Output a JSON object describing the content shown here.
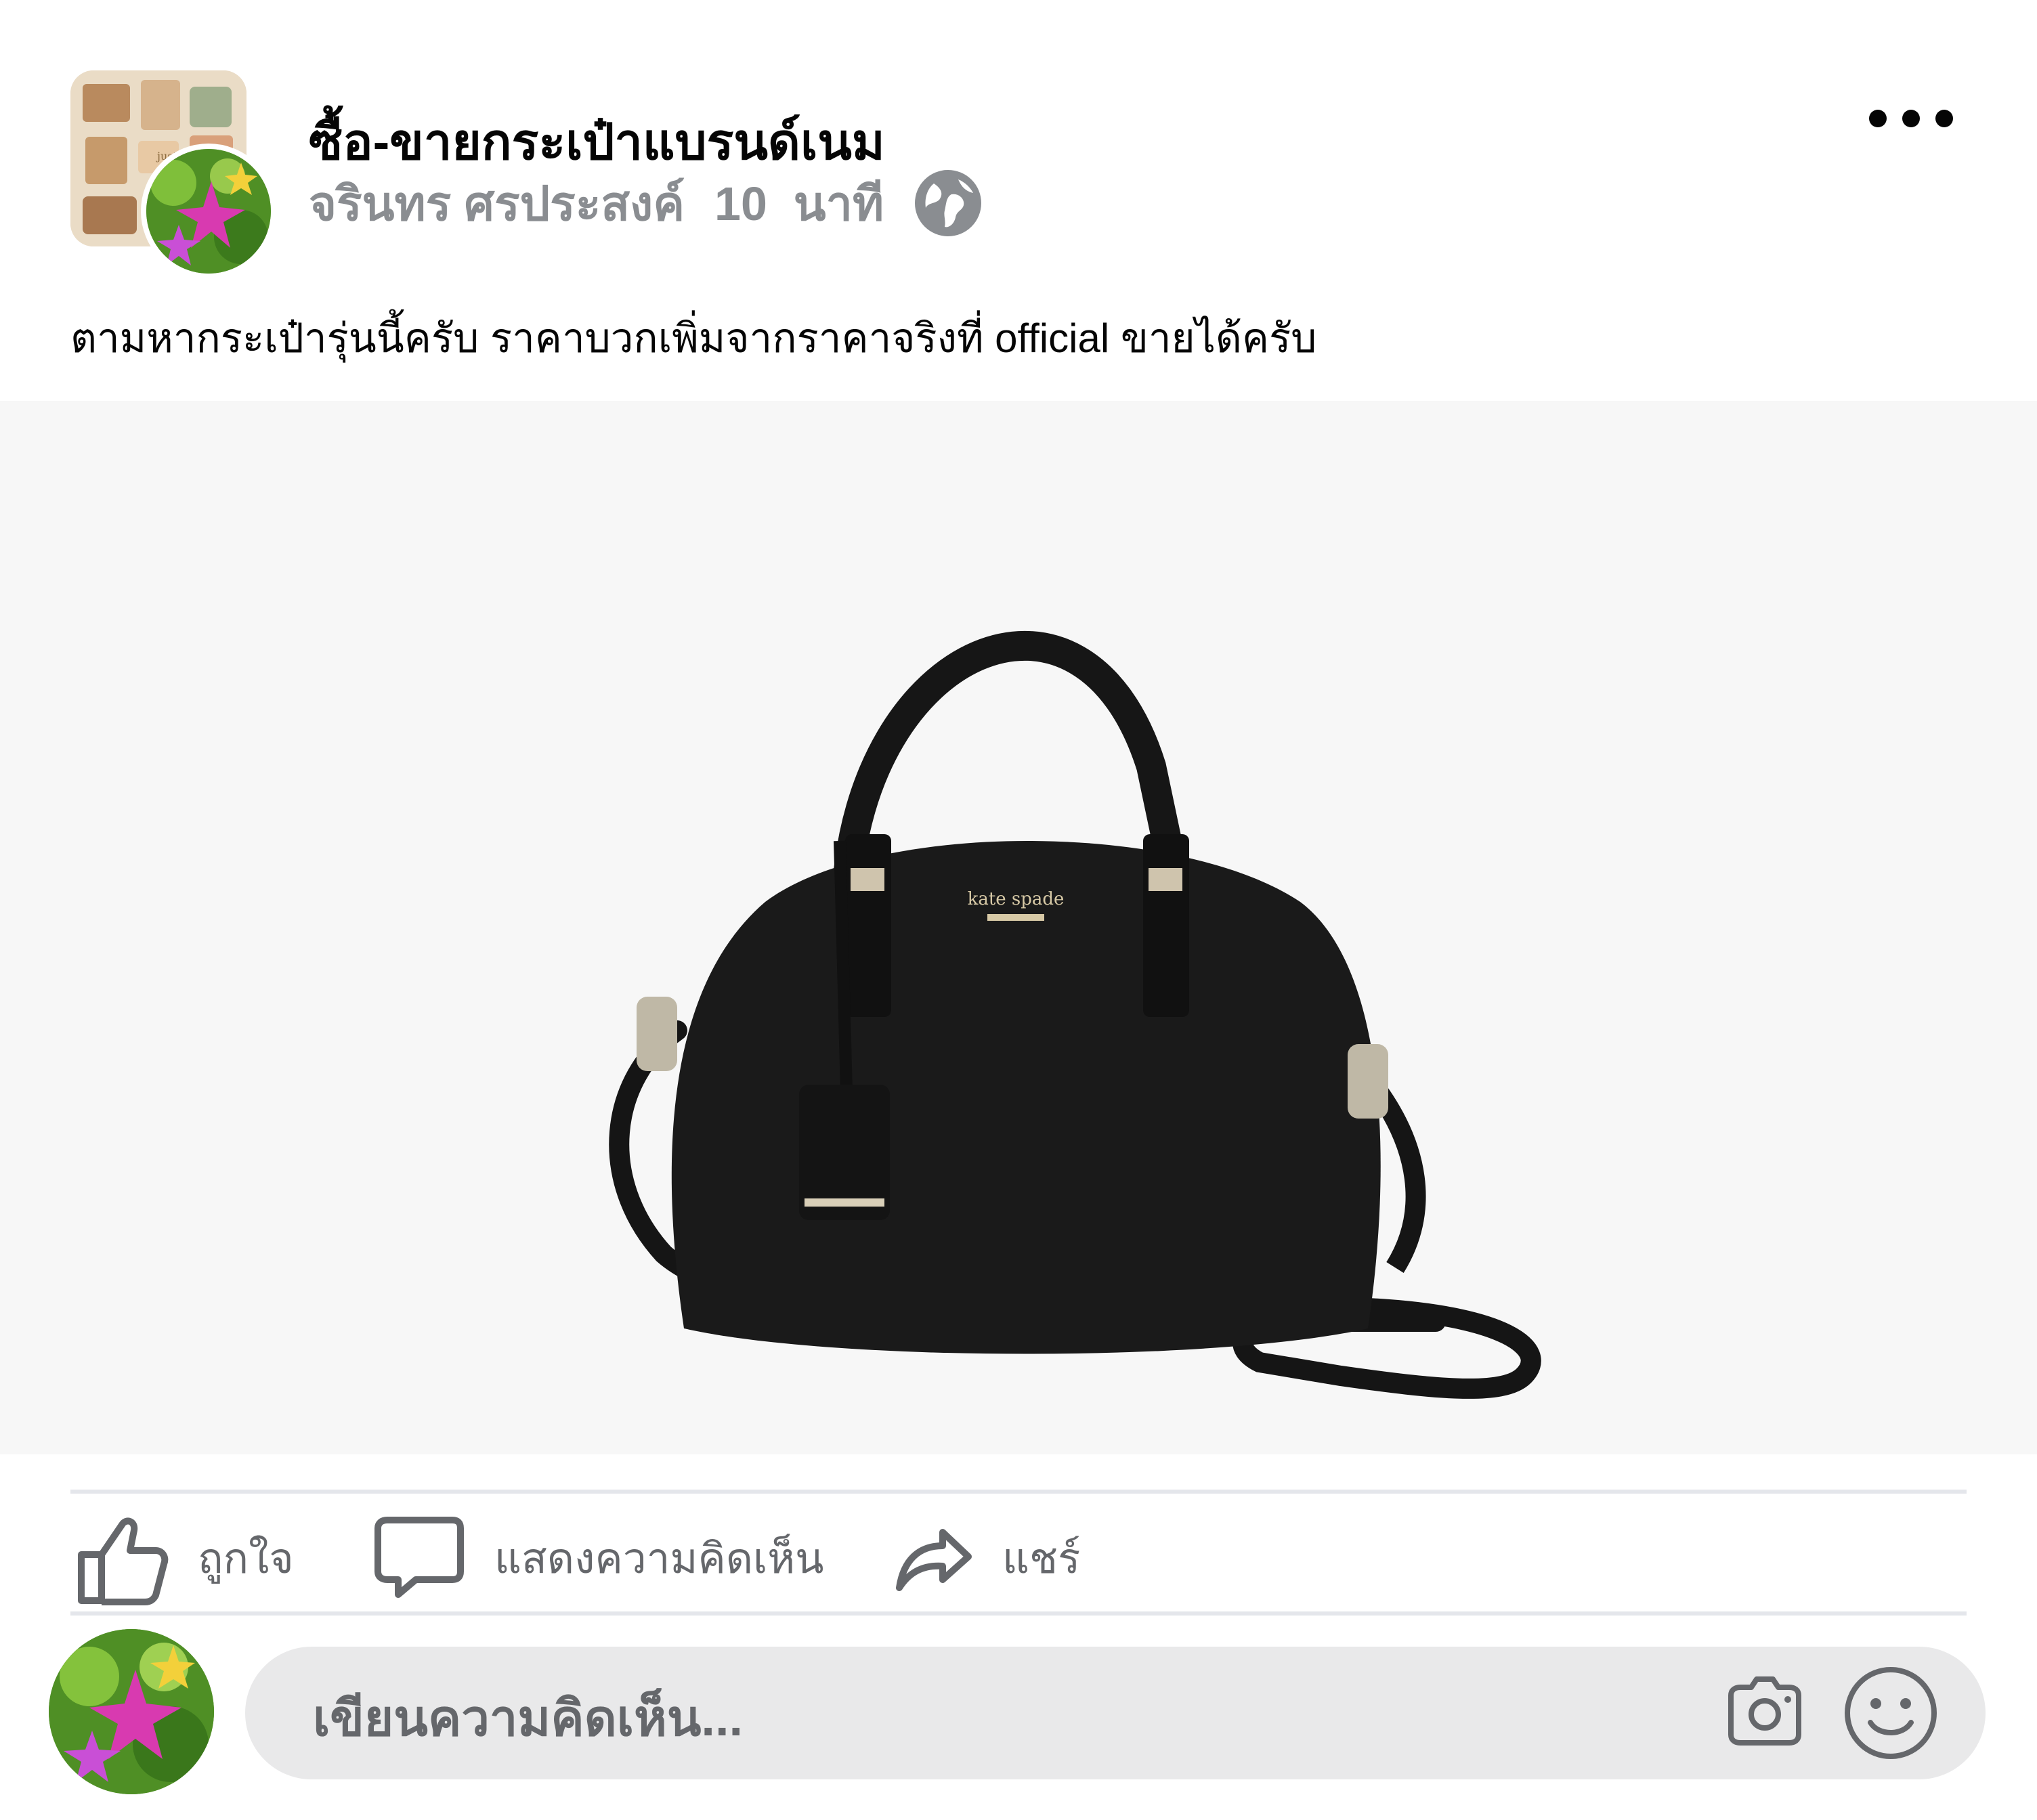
{
  "post": {
    "group_name": "ซื้อ-ขายกระเป๋าแบรนด์เนม",
    "author": "จรินทร ศรประสงค์",
    "time_ago": "10  นาที",
    "privacy_icon": "globe-icon",
    "caption": "ตามหากระเป๋ารุ่นนี้ครับ ราคาบวกเพิ่มจากราคาจริงที่ official ขายได้ครับ",
    "photo": {
      "brand_text": "kate spade"
    }
  },
  "actions": {
    "like_label": "ถูกใจ",
    "comment_label": "แสดงความคิดเห็น",
    "share_label": "แชร์"
  },
  "composer": {
    "placeholder": "เขียนความคิดเห็น...",
    "icons": [
      "camera-icon",
      "emoji-icon"
    ]
  },
  "colors": {
    "text_primary": "#050505",
    "text_secondary": "#65676b",
    "meta_gray": "#8a8d91",
    "divider": "#e4e6eb",
    "composer_bg": "#e9e9ea"
  }
}
